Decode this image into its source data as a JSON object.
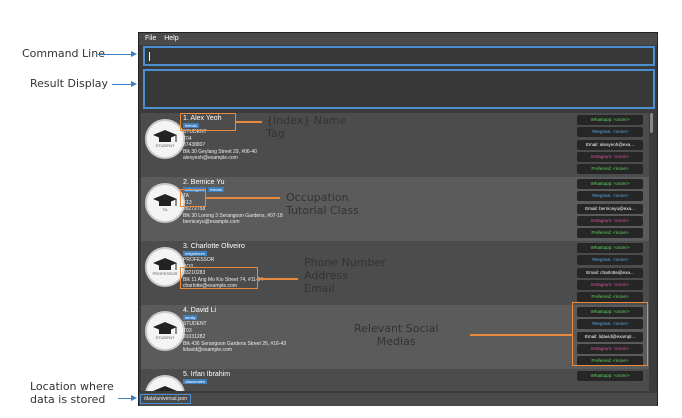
{
  "menu": [
    "File",
    "Help"
  ],
  "callouts": {
    "command_line": "Command Line",
    "result_display": "Result Display",
    "location": "Location where\ndata is stored",
    "index_name_tag": "{Index} Name\nTag",
    "occupation": "Occupation\nTutorial Class",
    "phone_address_email": "Phone Number\nAddress\nEmail",
    "socials": "Relevant Social\nMedias"
  },
  "persons": [
    {
      "header": "1. Alex Yeoh",
      "tags": [
        "friends"
      ],
      "occupation": "STUDENT",
      "tutorial": "T04",
      "phone": "87438807",
      "address": "Blk 30 Geylang Street 29, #06-40",
      "email": "alexyeoh@example.com",
      "avatar_label": "STUDENT",
      "avatar_icon": "graduation-cap-icon"
    },
    {
      "header": "2. Bernice Yu",
      "tags": [
        "colleagues",
        "friends"
      ],
      "occupation": "TA",
      "tutorial": "F13",
      "phone": "99272758",
      "address": "Blk 30 Lorong 3 Serangoon Gardens, #07-18",
      "email": "berniceyu@example.com",
      "avatar_label": "TA",
      "avatar_icon": "teaching-assistant-icon"
    },
    {
      "header": "3. Charlotte Oliveiro",
      "tags": [
        "neighbours"
      ],
      "occupation": "PROFESSOR",
      "tutorial": "W10",
      "phone": "93210283",
      "address": "Blk 11 Ang Mo Kio Street 74, #11-04",
      "email": "charlotte@example.com",
      "avatar_label": "PROFESSOR",
      "avatar_icon": "professor-icon"
    },
    {
      "header": "4. David Li",
      "tags": [
        "family"
      ],
      "occupation": "STUDENT",
      "tutorial": "T03",
      "phone": "91031282",
      "address": "Blk 436 Serangoon Gardens Street 26, #16-43",
      "email": "lidavid@example.com",
      "avatar_label": "STUDENT",
      "avatar_icon": "graduation-cap-icon"
    },
    {
      "header": "5. Irfan Ibrahim",
      "tags": [
        "classmates"
      ],
      "occupation": "",
      "tutorial": "",
      "phone": "",
      "address": "",
      "email": "",
      "avatar_label": "",
      "avatar_icon": "graduation-cap-icon"
    }
  ],
  "socials": [
    [
      "Whatsapp: <none>",
      "Telegram: <none>",
      "Email: alexyeoh@exa...",
      "Instagram: <none>",
      "Preferred: <none>"
    ],
    [
      "Whatsapp: <none>",
      "Telegram: <none>",
      "Email: berniceyu@exa...",
      "Instagram: <none>",
      "Preferred: <none>"
    ],
    [
      "Whatsapp: <none>",
      "Telegram: <none>",
      "Email: charlotte@exa...",
      "Instagram: <none>",
      "Preferred: <none>"
    ],
    [
      "Whatsapp: <none>",
      "Telegram: <none>",
      "Email: lidavid@exampl...",
      "Instagram: <none>",
      "Preferred: <none>"
    ],
    [
      "Whatsapp: <none>"
    ]
  ],
  "social_colors": [
    "#5fd35f",
    "#5aa9e6",
    "#ffffff",
    "#e0529c",
    "#5fd35f"
  ],
  "status": {
    "path": "/data\\universal.json"
  }
}
